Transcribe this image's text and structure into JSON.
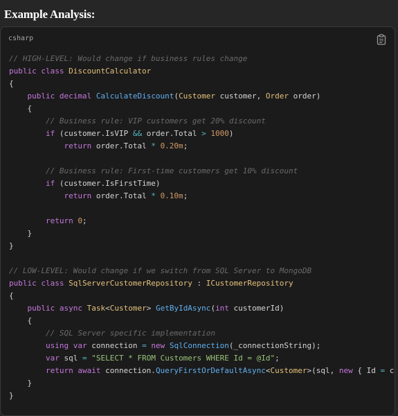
{
  "heading": "Example Analysis:",
  "code_block": {
    "language": "csharp",
    "copy_icon": "clipboard-icon",
    "colors": {
      "comment": "#6a6a6a",
      "keyword": "#c678dd",
      "class": "#e5c07b",
      "method": "#61afef",
      "number": "#d19a66",
      "string": "#98c379",
      "operator": "#56b6c2",
      "plain": "#d4d4d4"
    },
    "lines": [
      [
        {
          "t": "// HIGH-LEVEL: Would change if business rules change",
          "c": "comment"
        }
      ],
      [
        {
          "t": "public class ",
          "c": "keyword"
        },
        {
          "t": "DiscountCalculator",
          "c": "class"
        }
      ],
      [
        {
          "t": "{",
          "c": "plain"
        }
      ],
      [
        {
          "t": "    public decimal ",
          "c": "keyword"
        },
        {
          "t": "CalculateDiscount",
          "c": "method"
        },
        {
          "t": "(",
          "c": "plain"
        },
        {
          "t": "Customer",
          "c": "type"
        },
        {
          "t": " customer, ",
          "c": "plain"
        },
        {
          "t": "Order",
          "c": "type"
        },
        {
          "t": " order)",
          "c": "plain"
        }
      ],
      [
        {
          "t": "    {",
          "c": "plain"
        }
      ],
      [
        {
          "t": "        // Business rule: VIP customers get 20% discount",
          "c": "comment"
        }
      ],
      [
        {
          "t": "        if",
          "c": "keyword"
        },
        {
          "t": " (customer.IsVIP ",
          "c": "plain"
        },
        {
          "t": "&&",
          "c": "op"
        },
        {
          "t": " order.Total ",
          "c": "plain"
        },
        {
          "t": ">",
          "c": "op"
        },
        {
          "t": " ",
          "c": "plain"
        },
        {
          "t": "1000",
          "c": "number"
        },
        {
          "t": ")",
          "c": "plain"
        }
      ],
      [
        {
          "t": "            return",
          "c": "keyword"
        },
        {
          "t": " order.Total ",
          "c": "plain"
        },
        {
          "t": "*",
          "c": "op"
        },
        {
          "t": " ",
          "c": "plain"
        },
        {
          "t": "0.20m",
          "c": "number"
        },
        {
          "t": ";",
          "c": "plain"
        }
      ],
      [],
      [
        {
          "t": "        // Business rule: First-time customers get 10% discount",
          "c": "comment"
        }
      ],
      [
        {
          "t": "        if",
          "c": "keyword"
        },
        {
          "t": " (customer.IsFirstTime)",
          "c": "plain"
        }
      ],
      [
        {
          "t": "            return",
          "c": "keyword"
        },
        {
          "t": " order.Total ",
          "c": "plain"
        },
        {
          "t": "*",
          "c": "op"
        },
        {
          "t": " ",
          "c": "plain"
        },
        {
          "t": "0.10m",
          "c": "number"
        },
        {
          "t": ";",
          "c": "plain"
        }
      ],
      [],
      [
        {
          "t": "        return",
          "c": "keyword"
        },
        {
          "t": " ",
          "c": "plain"
        },
        {
          "t": "0",
          "c": "number"
        },
        {
          "t": ";",
          "c": "plain"
        }
      ],
      [
        {
          "t": "    }",
          "c": "plain"
        }
      ],
      [
        {
          "t": "}",
          "c": "plain"
        }
      ],
      [],
      [
        {
          "t": "// LOW-LEVEL: Would change if we switch from SQL Server to MongoDB",
          "c": "comment"
        }
      ],
      [
        {
          "t": "public class ",
          "c": "keyword"
        },
        {
          "t": "SqlServerCustomerRepository",
          "c": "class"
        },
        {
          "t": " : ",
          "c": "plain"
        },
        {
          "t": "ICustomerRepository",
          "c": "class"
        }
      ],
      [
        {
          "t": "{",
          "c": "plain"
        }
      ],
      [
        {
          "t": "    public async ",
          "c": "keyword"
        },
        {
          "t": "Task",
          "c": "type"
        },
        {
          "t": "<",
          "c": "plain"
        },
        {
          "t": "Customer",
          "c": "type"
        },
        {
          "t": "> ",
          "c": "plain"
        },
        {
          "t": "GetByIdAsync",
          "c": "method"
        },
        {
          "t": "(",
          "c": "plain"
        },
        {
          "t": "int",
          "c": "keyword"
        },
        {
          "t": " customerId)",
          "c": "plain"
        }
      ],
      [
        {
          "t": "    {",
          "c": "plain"
        }
      ],
      [
        {
          "t": "        // SQL Server specific implementation",
          "c": "comment"
        }
      ],
      [
        {
          "t": "        using var",
          "c": "keyword"
        },
        {
          "t": " connection ",
          "c": "plain"
        },
        {
          "t": "=",
          "c": "op"
        },
        {
          "t": " ",
          "c": "plain"
        },
        {
          "t": "new ",
          "c": "keyword"
        },
        {
          "t": "SqlConnection",
          "c": "method"
        },
        {
          "t": "(_connectionString);",
          "c": "plain"
        }
      ],
      [
        {
          "t": "        var",
          "c": "keyword"
        },
        {
          "t": " sql ",
          "c": "plain"
        },
        {
          "t": "=",
          "c": "op"
        },
        {
          "t": " ",
          "c": "plain"
        },
        {
          "t": "\"SELECT * FROM Customers WHERE Id = @Id\"",
          "c": "string"
        },
        {
          "t": ";",
          "c": "plain"
        }
      ],
      [
        {
          "t": "        return await",
          "c": "keyword"
        },
        {
          "t": " connection.",
          "c": "plain"
        },
        {
          "t": "QueryFirstOrDefaultAsync",
          "c": "method"
        },
        {
          "t": "<",
          "c": "plain"
        },
        {
          "t": "Customer",
          "c": "type"
        },
        {
          "t": ">(sql, ",
          "c": "plain"
        },
        {
          "t": "new",
          "c": "keyword"
        },
        {
          "t": " { Id ",
          "c": "plain"
        },
        {
          "t": "=",
          "c": "op"
        },
        {
          "t": " customerId });",
          "c": "plain"
        }
      ],
      [
        {
          "t": "    }",
          "c": "plain"
        }
      ],
      [
        {
          "t": "}",
          "c": "plain"
        }
      ]
    ]
  }
}
